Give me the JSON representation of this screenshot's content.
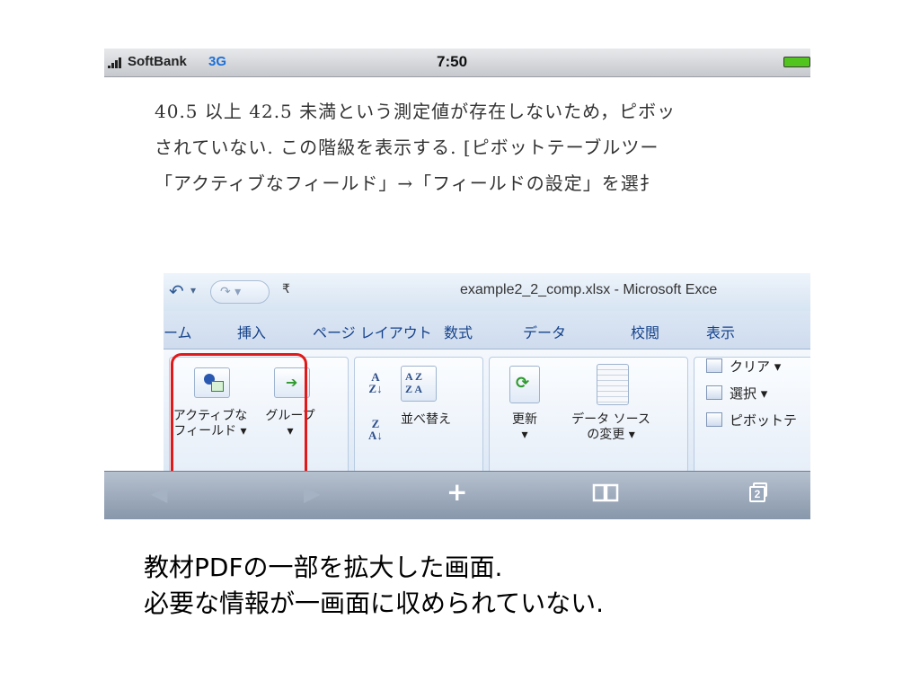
{
  "status_bar": {
    "carrier": "SoftBank",
    "network": "3G",
    "time": "7:50",
    "battery_color": "#51c51d"
  },
  "pdf_text": {
    "lines": [
      "40.5 以上 42.5 未満という測定値が存在しないため，ピボッ",
      "されていない. この階級を表示する. [ピボットテーブルツー",
      "「アクティブなフィールド」→「フィールドの設定」を選扌"
    ]
  },
  "excel": {
    "window_title": "example2_2_comp.xlsx - Microsoft Exce",
    "quick_access": {
      "undo_icon": "undo-icon",
      "redo_icon": "redo-icon",
      "customize": "₹"
    },
    "tabs": [
      "ーム",
      "挿入",
      "ページ レイアウト",
      "数式",
      "データ",
      "校閲",
      "表示"
    ],
    "ribbon": {
      "active_field": "アクティブな\nフィールド ▾",
      "group": "グループ\n▾",
      "sort": "並べ替え",
      "refresh": "更新\n▾",
      "change_source": "データ ソース\nの変更 ▾",
      "clear": "クリア ▾",
      "select": "選択 ▾",
      "pivot": "ピボットテ"
    },
    "highlight_color": "#e01a1a"
  },
  "toolbar": {
    "back": "◀",
    "forward": "▶",
    "add": "+",
    "bookmarks_icon": "book-icon",
    "pages_count": "2"
  },
  "caption": {
    "line1": "教材PDFの一部を拡大した画面.",
    "line2": "必要な情報が一画面に収められていない."
  }
}
